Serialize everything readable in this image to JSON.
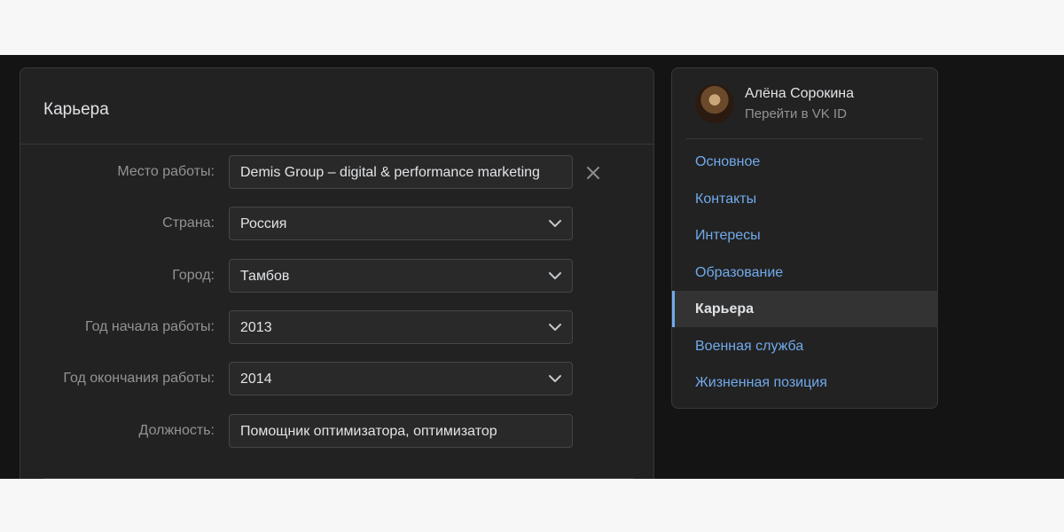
{
  "career": {
    "title": "Карьера",
    "fields": [
      {
        "label": "Место работы:",
        "value": "Demis Group – digital & performance marketing",
        "type": "text",
        "clearable": true
      },
      {
        "label": "Страна:",
        "value": "Россия",
        "type": "select"
      },
      {
        "label": "Город:",
        "value": "Тамбов",
        "type": "select"
      },
      {
        "label": "Год начала работы:",
        "value": "2013",
        "type": "select"
      },
      {
        "label": "Год окончания работы:",
        "value": "2014",
        "type": "select"
      },
      {
        "label": "Должность:",
        "value": "Помощник оптимизатора, оптимизатор",
        "type": "text"
      }
    ],
    "clear_icon": "close-icon"
  },
  "sidebar": {
    "user_name": "Алёна Сорокина",
    "user_link": "Перейти в VK ID",
    "items": [
      {
        "label": "Основное",
        "active": false
      },
      {
        "label": "Контакты",
        "active": false
      },
      {
        "label": "Интересы",
        "active": false
      },
      {
        "label": "Образование",
        "active": false
      },
      {
        "label": "Карьера",
        "active": true
      },
      {
        "label": "Военная служба",
        "active": false
      },
      {
        "label": "Жизненная позиция",
        "active": false
      }
    ]
  },
  "colors": {
    "background": "#141414",
    "card": "#222222",
    "accent": "#71aaeb",
    "text": "#e1e3e6",
    "muted": "#939393"
  }
}
